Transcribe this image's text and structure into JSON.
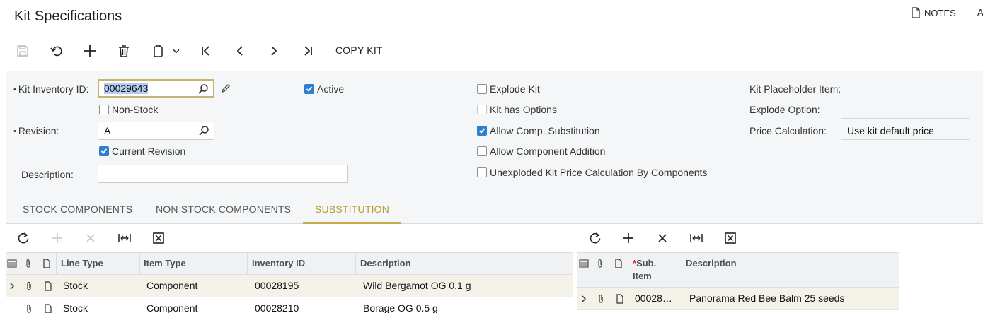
{
  "header": {
    "title": "Kit Specifications",
    "notes_label": "NOTES",
    "overflow_label": "A"
  },
  "toolbar": {
    "icons": [
      "save-icon",
      "undo-icon",
      "add-icon",
      "delete-icon",
      "clipboard-icon",
      "chevron-down-icon",
      "first-icon",
      "previous-icon",
      "next-icon",
      "last-icon"
    ],
    "copy_kit_label": "COPY KIT"
  },
  "form": {
    "kit_inventory_id": {
      "label": "Kit Inventory ID:",
      "value": "00029643",
      "required_mark": "•"
    },
    "non_stock": {
      "label": "Non-Stock",
      "checked": false
    },
    "revision": {
      "label": "Revision:",
      "value": "A",
      "required_mark": "•"
    },
    "current_revision": {
      "label": "Current Revision",
      "checked": true
    },
    "description": {
      "label": "Description:",
      "value": ""
    },
    "active": {
      "label": "Active",
      "checked": true
    },
    "explode_kit": {
      "label": "Explode Kit",
      "checked": false
    },
    "kit_has_options": {
      "label": "Kit has Options",
      "checked": false
    },
    "allow_comp_substitution": {
      "label": "Allow Comp. Substitution",
      "checked": true
    },
    "allow_component_addition": {
      "label": "Allow Component Addition",
      "checked": false
    },
    "unexploded_price": {
      "label": "Unexploded Kit Price Calculation By Components",
      "checked": false
    },
    "kit_placeholder_item": {
      "label": "Kit Placeholder Item:",
      "value": ""
    },
    "explode_option": {
      "label": "Explode Option:",
      "value": ""
    },
    "price_calculation": {
      "label": "Price Calculation:",
      "value": "Use kit default price"
    }
  },
  "tabs": [
    {
      "label": "STOCK COMPONENTS",
      "active": false
    },
    {
      "label": "NON STOCK COMPONENTS",
      "active": false
    },
    {
      "label": "SUBSTITUTION",
      "active": true
    }
  ],
  "left_grid": {
    "columns": [
      "Line Type",
      "Item Type",
      "Inventory ID",
      "Description"
    ],
    "rows": [
      {
        "line_type": "Stock",
        "item_type": "Component",
        "inventory_id": "00028195",
        "description": "Wild Bergamot OG 0.1 g"
      },
      {
        "line_type": "Stock",
        "item_type": "Component",
        "inventory_id": "00028210",
        "description": "Borage OG 0.5 g"
      }
    ]
  },
  "right_grid": {
    "columns": [
      "Sub. Item",
      "Description"
    ],
    "required_mark": "*",
    "sub_item_line1": "Sub.",
    "sub_item_line2": "Item",
    "rows": [
      {
        "sub_item": "00028…",
        "description": "Panorama Red Bee Balm 25 seeds"
      }
    ]
  },
  "colors": {
    "accent": "#c2ab48",
    "checkbox": "#2f7fd1",
    "focus_border": "#c7b56d",
    "selection": "#b4cef0"
  }
}
